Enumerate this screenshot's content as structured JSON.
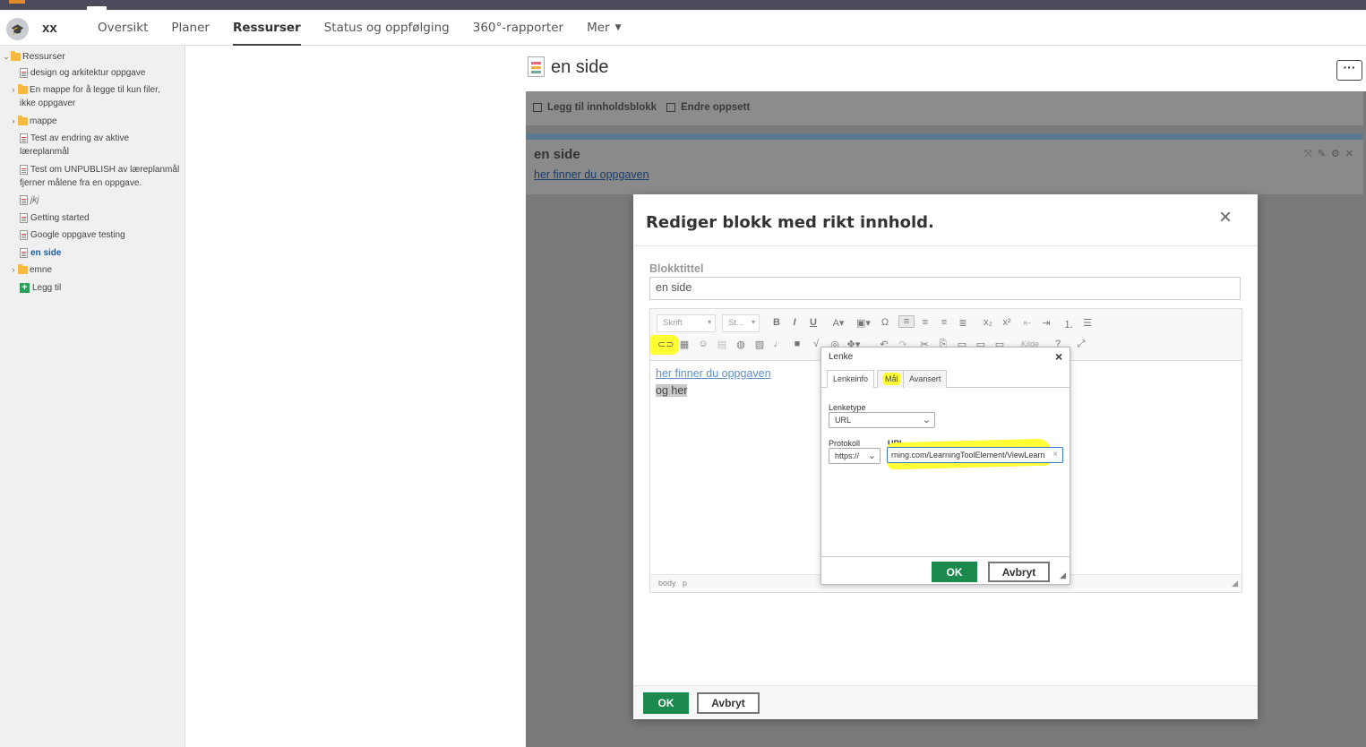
{
  "header": {
    "course_name": "xx",
    "nav": [
      "Oversikt",
      "Planer",
      "Ressurser",
      "Status og oppfølging",
      "360°-rapporter",
      "Mer"
    ]
  },
  "sidebar": {
    "root": "Ressurser",
    "items": [
      {
        "label": "design og arkitektur oppgave",
        "type": "doc"
      },
      {
        "label": "En mappe for å legge til kun filer,",
        "label2": "ikke oppgaver",
        "type": "folder"
      },
      {
        "label": "mappe",
        "type": "folder"
      },
      {
        "label": "Test av endring av aktive",
        "label2": "læreplanmål",
        "type": "doc"
      },
      {
        "label": "Test om UNPUBLISH av læreplanmål",
        "label2": "fjerner målene fra en oppgave.",
        "type": "doc"
      },
      {
        "label": "jkj",
        "type": "doc"
      },
      {
        "label": "Getting started",
        "type": "doc"
      },
      {
        "label": "Google oppgave testing",
        "type": "doc"
      },
      {
        "label": "en side",
        "type": "doc"
      },
      {
        "label": "emne",
        "type": "folder"
      }
    ],
    "add_label": "Legg til"
  },
  "page": {
    "title": "en side",
    "more_label": "···",
    "toolbar": {
      "add_block": "Legg til innholdsblokk",
      "change_layout": "Endre oppsett"
    },
    "block": {
      "title": "en side",
      "link": "her finner du oppgaven"
    }
  },
  "modal": {
    "title": "Rediger blokk med rikt innhold.",
    "close": "×",
    "field_label": "Blokktittel",
    "field_value": "en side",
    "editor": {
      "font_combo": "Skrift",
      "style_combo": "St...",
      "source_label": "Kilde",
      "content_link": "her finner du oppgaven",
      "content_text": "og her",
      "path": [
        "body",
        "p"
      ]
    },
    "ok": "OK",
    "cancel": "Avbryt"
  },
  "link_dialog": {
    "title": "Lenke",
    "close": "×",
    "tabs": [
      "Lenkeinfo",
      "Mål",
      "Avansert"
    ],
    "link_type_label": "Lenketype",
    "link_type_value": "URL",
    "protocol_label": "Protokoll",
    "protocol_value": "https://",
    "url_label": "URL",
    "url_value": "rning.com/LearningToolElement/ViewLearn",
    "ok": "OK",
    "cancel": "Avbryt"
  },
  "colors": {
    "highlight": "#ffff33",
    "ok_green": "#1b8a4c",
    "link_blue": "#1a5fa8",
    "overlay": "#7a7a7a"
  }
}
